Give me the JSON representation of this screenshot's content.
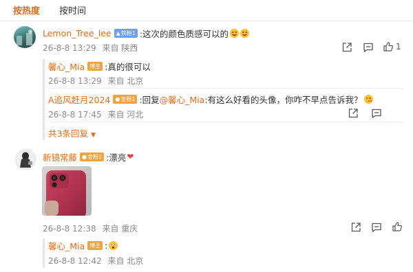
{
  "tabs": [
    {
      "label": "按热度",
      "active": true
    },
    {
      "label": "按时间",
      "active": false
    }
  ],
  "comments": [
    {
      "user": "Lemon_Tree_lee",
      "badge": "铁粉1",
      "text": ":这次的颜色质感可以的",
      "time": "26-8-8 13:29",
      "location": "来自 陕西",
      "likes": "1",
      "replies": [
        {
          "user": "馨心_Mia",
          "badge": "博主",
          "text": ":真的很可以",
          "time": "26-8-8 13:29",
          "location": "来自 北京"
        },
        {
          "user": "A追风赶月2024",
          "badge": "金粉1",
          "prefix": ":回复 ",
          "mention": "@馨心_Mia",
          "text": ":有这么好看的头像，你咋不早点告诉我？",
          "time": "26-8-8 17:45",
          "location": "来自 河北"
        }
      ],
      "more_label": "共3条回复"
    },
    {
      "user": "新镜常藤",
      "badge": "金粉1",
      "text": ":漂亮",
      "time": "26-8-8 12:38",
      "location": "来自 重庆",
      "replies": [
        {
          "user": "馨心_Mia",
          "badge": "博主",
          "text": ":",
          "time": "26-8-8 12:42",
          "location": "来自 北京"
        }
      ]
    }
  ],
  "icons": {
    "share": "share-icon",
    "comment": "comment-icon",
    "like": "like-icon",
    "dropdown": "caret-down-icon"
  },
  "colors": {
    "accent": "#e06c17",
    "meta": "#8a8a8a",
    "badge_blue": "#6f9ff2",
    "badge_gold": "#f1a33c"
  }
}
